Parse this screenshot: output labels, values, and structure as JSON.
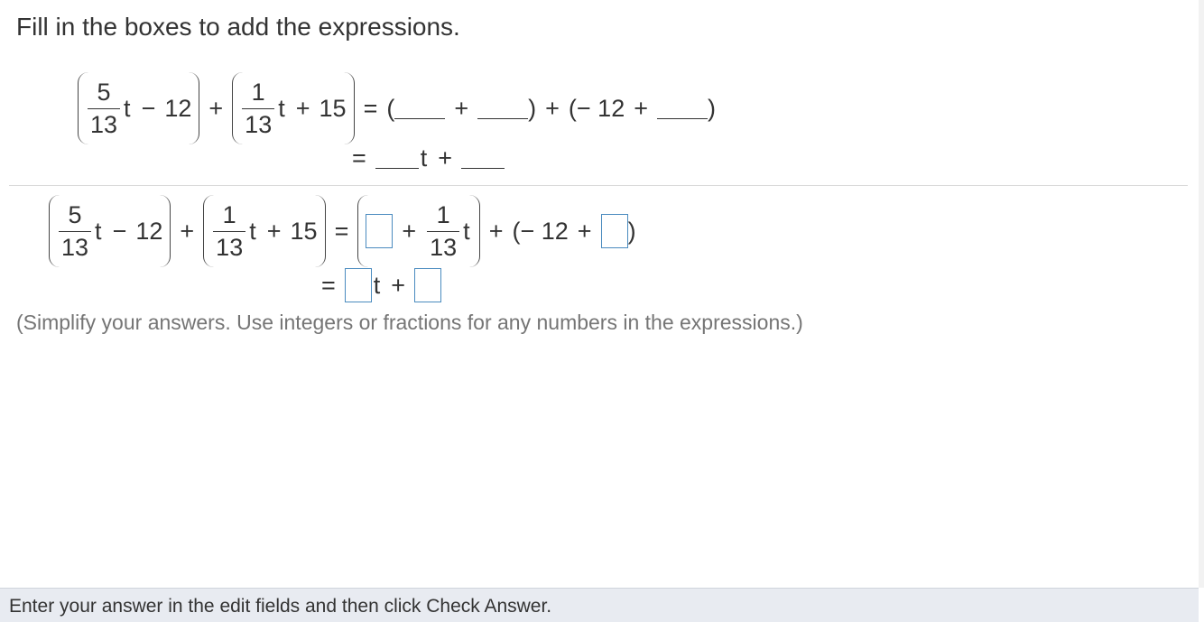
{
  "instruction": "Fill in the boxes to add the expressions.",
  "math": {
    "a_num": "5",
    "a_den": "13",
    "c1": "12",
    "b_num": "1",
    "b_den": "13",
    "c2": "15",
    "var": "t",
    "plus": "+",
    "minus": "−",
    "equals": "=",
    "open_paren": "(",
    "close_paren": ")",
    "minus12": "− 12"
  },
  "answer_boxes": [
    {
      "id": "box1",
      "value": ""
    },
    {
      "id": "box2",
      "value": ""
    },
    {
      "id": "box3",
      "value": ""
    },
    {
      "id": "box4",
      "value": ""
    }
  ],
  "note": "(Simplify your answers. Use integers or fractions for any numbers in the expressions.)",
  "footer_text": "Enter your answer in the edit fields and then click Check Answer.",
  "colors": {
    "box_border": "#4a8bbf",
    "footer_bg": "#e8ebf1"
  }
}
